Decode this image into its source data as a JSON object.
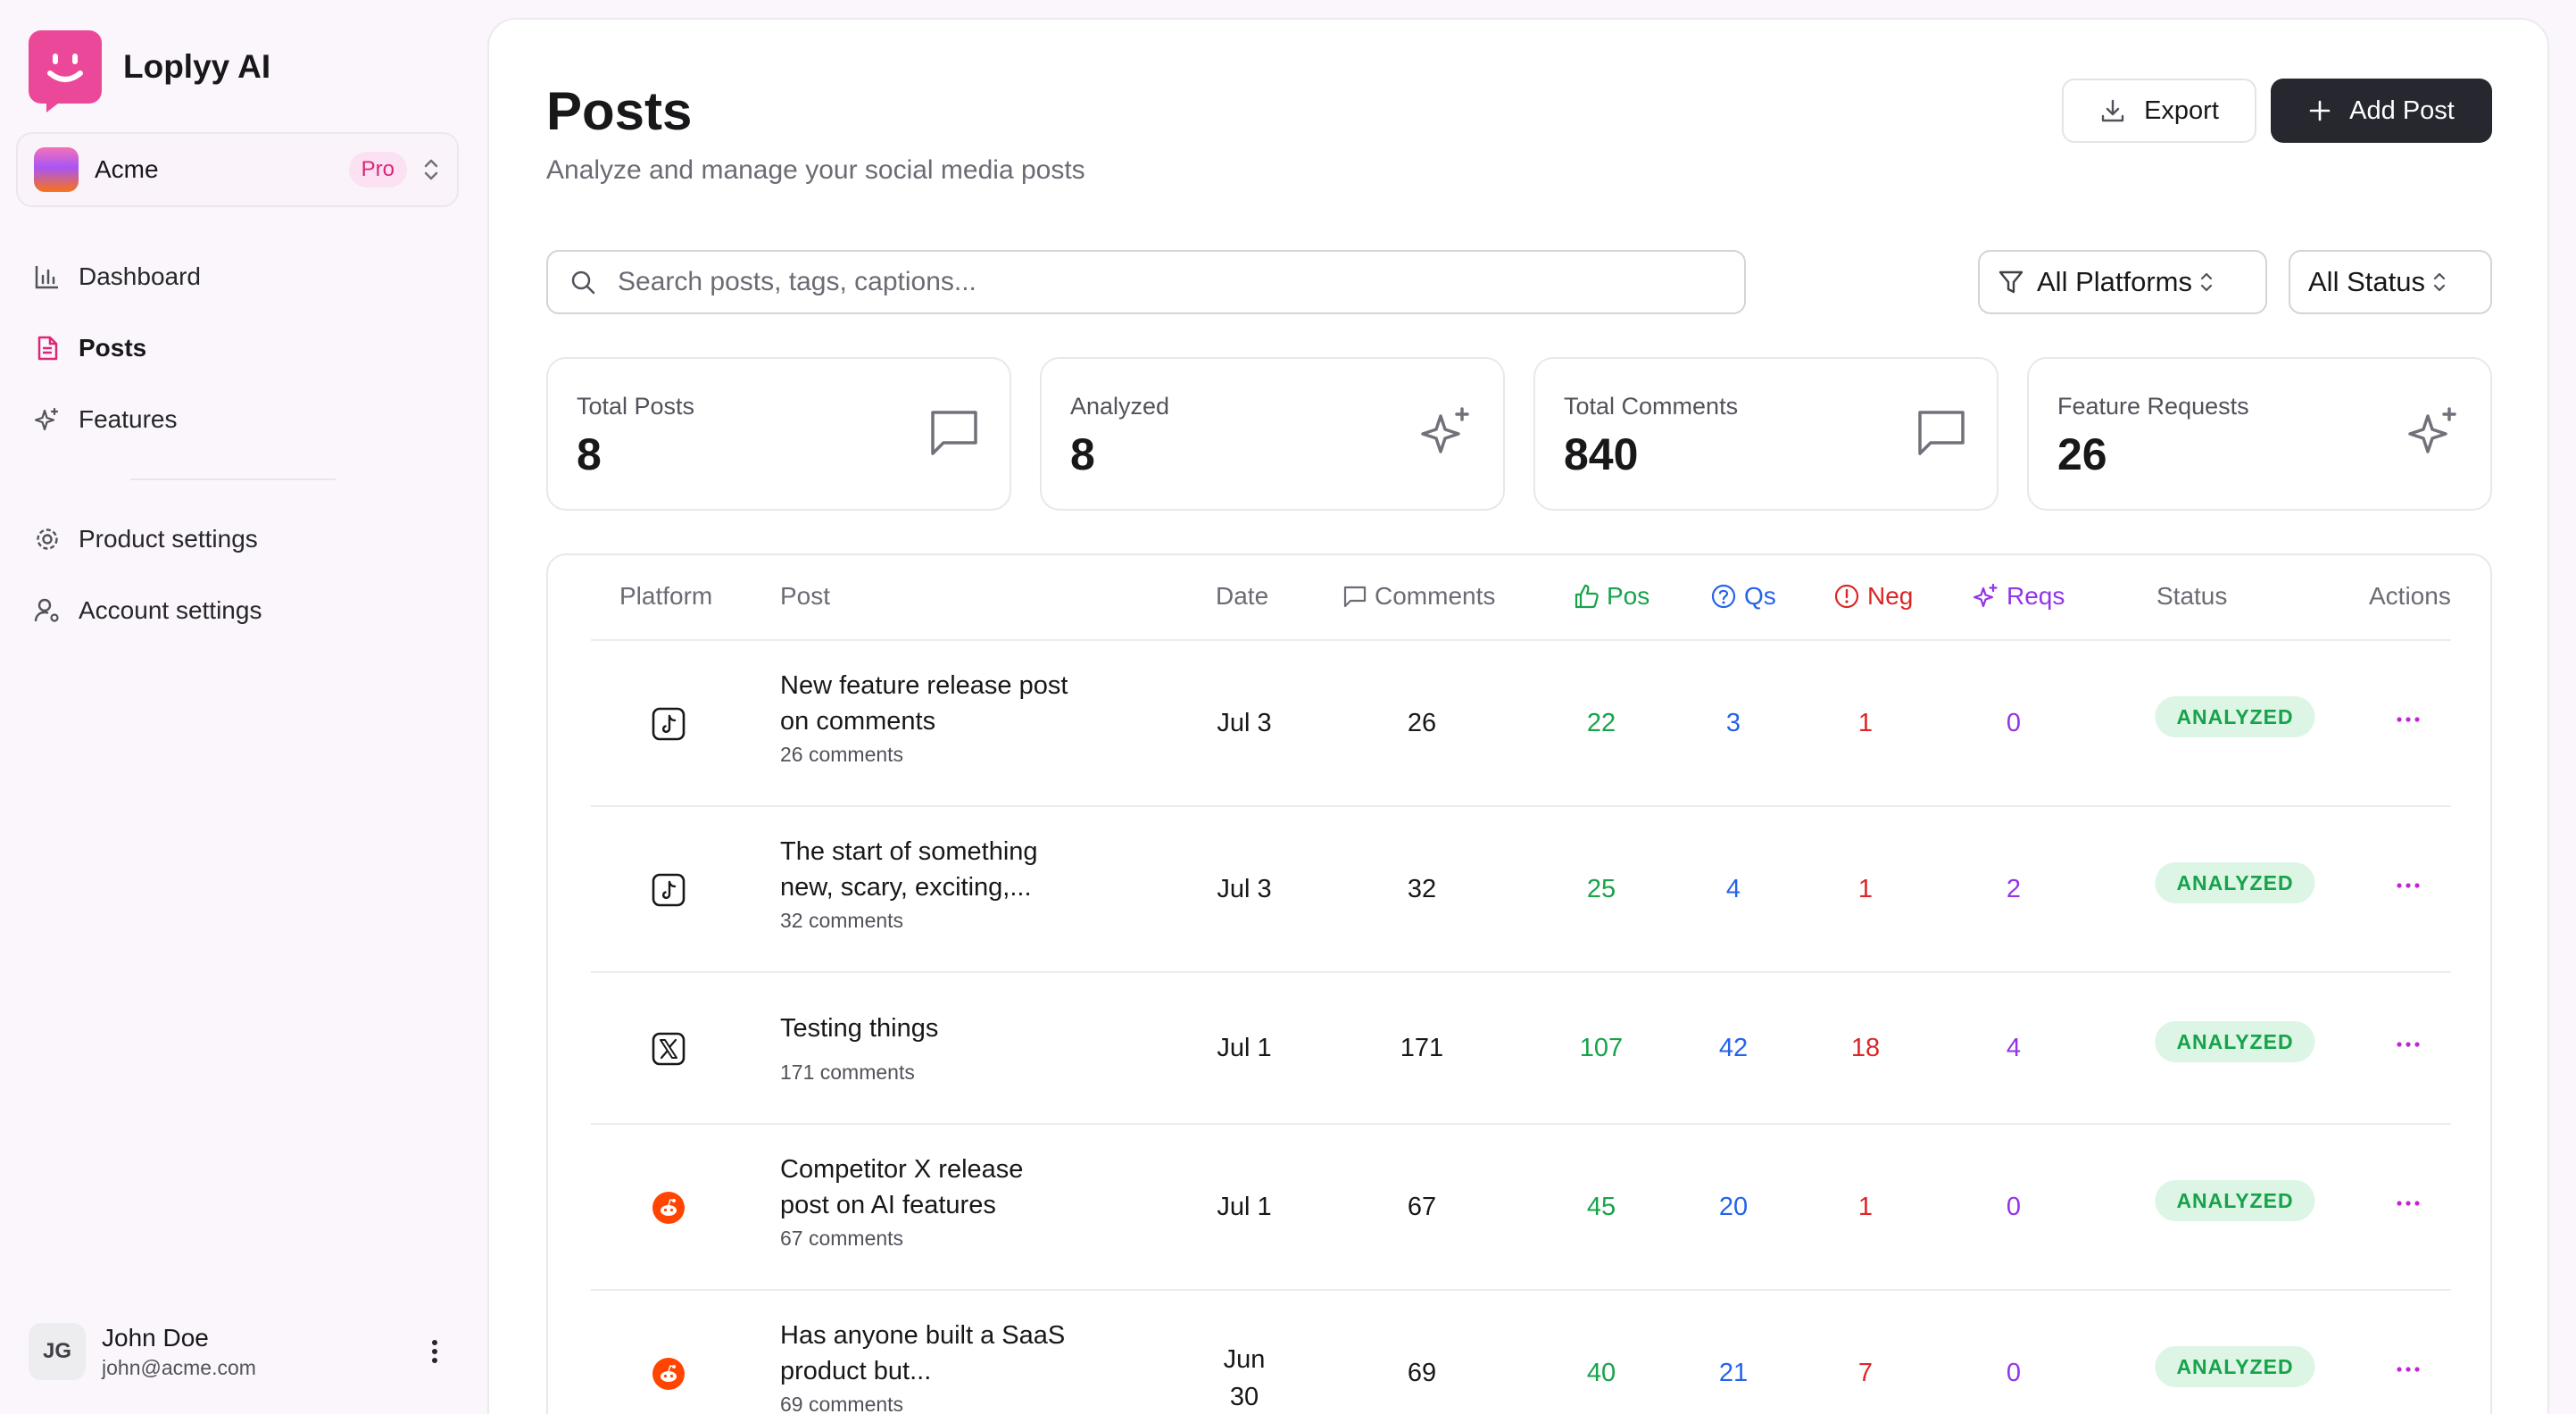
{
  "brand": {
    "name": "Loplyy AI"
  },
  "org": {
    "name": "Acme",
    "plan": "Pro"
  },
  "nav": {
    "items": [
      {
        "label": "Dashboard",
        "icon": "bar-chart-icon",
        "active": false
      },
      {
        "label": "Posts",
        "icon": "file-text-icon",
        "active": true
      },
      {
        "label": "Features",
        "icon": "sparkles-icon",
        "active": false
      }
    ],
    "settings": [
      {
        "label": "Product settings",
        "icon": "gear-icon"
      },
      {
        "label": "Account settings",
        "icon": "user-cog-icon"
      }
    ]
  },
  "user": {
    "initials": "JG",
    "name": "John Doe",
    "email": "john@acme.com"
  },
  "page": {
    "title": "Posts",
    "subtitle": "Analyze and manage your social media posts"
  },
  "actions": {
    "export_label": "Export",
    "add_label": "Add Post"
  },
  "search": {
    "placeholder": "Search posts, tags, captions..."
  },
  "filters": {
    "platform": "All Platforms",
    "status": "All Status"
  },
  "stats": [
    {
      "label": "Total Posts",
      "value": "8",
      "icon": "message-square-icon"
    },
    {
      "label": "Analyzed",
      "value": "8",
      "icon": "sparkles-icon"
    },
    {
      "label": "Total Comments",
      "value": "840",
      "icon": "message-square-icon"
    },
    {
      "label": "Feature Requests",
      "value": "26",
      "icon": "sparkles-icon"
    }
  ],
  "table": {
    "headers": {
      "platform": "Platform",
      "post": "Post",
      "date": "Date",
      "comments": "Comments",
      "pos": "Pos",
      "qs": "Qs",
      "neg": "Neg",
      "reqs": "Reqs",
      "status": "Status",
      "actions": "Actions"
    },
    "colors": {
      "pos": "#16a34a",
      "qs": "#2563eb",
      "neg": "#dc2626",
      "reqs": "#9333ea"
    },
    "rows": [
      {
        "platform": "tiktok",
        "title": "New feature release post on comments",
        "sub": "26 comments",
        "date": "Jul 3",
        "comments": "26",
        "pos": "22",
        "qs": "3",
        "neg": "1",
        "reqs": "0",
        "status": "ANALYZED"
      },
      {
        "platform": "tiktok",
        "title": "The start of something new, scary, exciting,...",
        "sub": "32 comments",
        "date": "Jul 3",
        "comments": "32",
        "pos": "25",
        "qs": "4",
        "neg": "1",
        "reqs": "2",
        "status": "ANALYZED"
      },
      {
        "platform": "x",
        "title": "Testing things",
        "sub": "171 comments",
        "date": "Jul 1",
        "comments": "171",
        "pos": "107",
        "qs": "42",
        "neg": "18",
        "reqs": "4",
        "status": "ANALYZED"
      },
      {
        "platform": "reddit",
        "title": "Competitor X release post on AI features",
        "sub": "67 comments",
        "date": "Jul 1",
        "comments": "67",
        "pos": "45",
        "qs": "20",
        "neg": "1",
        "reqs": "0",
        "status": "ANALYZED"
      },
      {
        "platform": "reddit",
        "title": "Has anyone built a SaaS product but...",
        "sub": "69 comments",
        "date": "Jun 30",
        "comments": "69",
        "pos": "40",
        "qs": "21",
        "neg": "7",
        "reqs": "0",
        "status": "ANALYZED"
      }
    ]
  }
}
